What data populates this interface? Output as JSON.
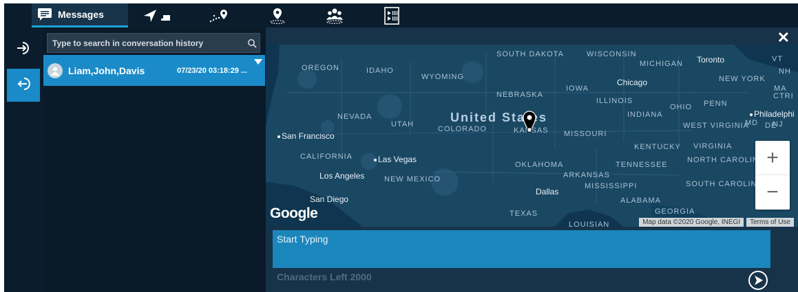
{
  "tabs": [
    {
      "id": "messages",
      "label": "Messages",
      "icon": "message-icon"
    },
    {
      "id": "navigate",
      "icon": "navigation-arrow-icon"
    },
    {
      "id": "route",
      "icon": "route-pin-icon"
    },
    {
      "id": "location",
      "icon": "location-person-icon"
    },
    {
      "id": "group",
      "icon": "group-location-icon"
    },
    {
      "id": "media",
      "icon": "media-panel-icon"
    }
  ],
  "rail": {
    "login_icon": "login-icon",
    "logout_icon": "logout-icon"
  },
  "search": {
    "placeholder": "Type to search in conversation history",
    "icon": "search-icon"
  },
  "conversations": [
    {
      "name": "Liam,John,Davis",
      "time": "07/23/20 03:18:29 ...",
      "icon": "user-avatar-icon"
    }
  ],
  "map": {
    "country_label": "United States",
    "states": [
      "OREGON",
      "IDAHO",
      "WYOMING",
      "SOUTH DAKOTA",
      "NEBRASKA",
      "IOWA",
      "WISCONSIN",
      "MICHIGAN",
      "ILLINOIS",
      "INDIANA",
      "OHIO",
      "PENN",
      "NEVADA",
      "UTAH",
      "COLORADO",
      "KANSAS",
      "MISSOURI",
      "CALIFORNIA",
      "OKLAHOMA",
      "ARKANSAS",
      "TENNESSEE",
      "KENTUCKY",
      "WEST VIRGINIA",
      "VIRGINIA",
      "NORTH CAROLINA",
      "SOUTH CAROLINA",
      "NEW MEXICO",
      "TEXAS",
      "MISSISSIPPI",
      "ALABAMA",
      "GEORGIA",
      "LOUISIAN",
      "NEW YORK",
      "MA",
      "CTRI",
      "VT",
      "NH",
      "NJ",
      "MD",
      "DE"
    ],
    "cities": [
      "San Francisco",
      "Las Vegas",
      "Los Angeles",
      "San Diego",
      "Dallas",
      "Chicago",
      "Toronto",
      "Philadelphi"
    ],
    "brand": "Google",
    "attribution": "Map data ©2020 Google, INEGI",
    "terms": "Terms of Use",
    "zoom_in": "+",
    "zoom_out": "−"
  },
  "composer": {
    "placeholder": "Start Typing",
    "chars_left": "Characters Left 2000"
  },
  "close_label": "✕",
  "colors": {
    "accent": "#1a8bc8",
    "panel_bg": "#17334a",
    "dark_bg": "#0a1a29",
    "map_bg": "#163e58"
  }
}
